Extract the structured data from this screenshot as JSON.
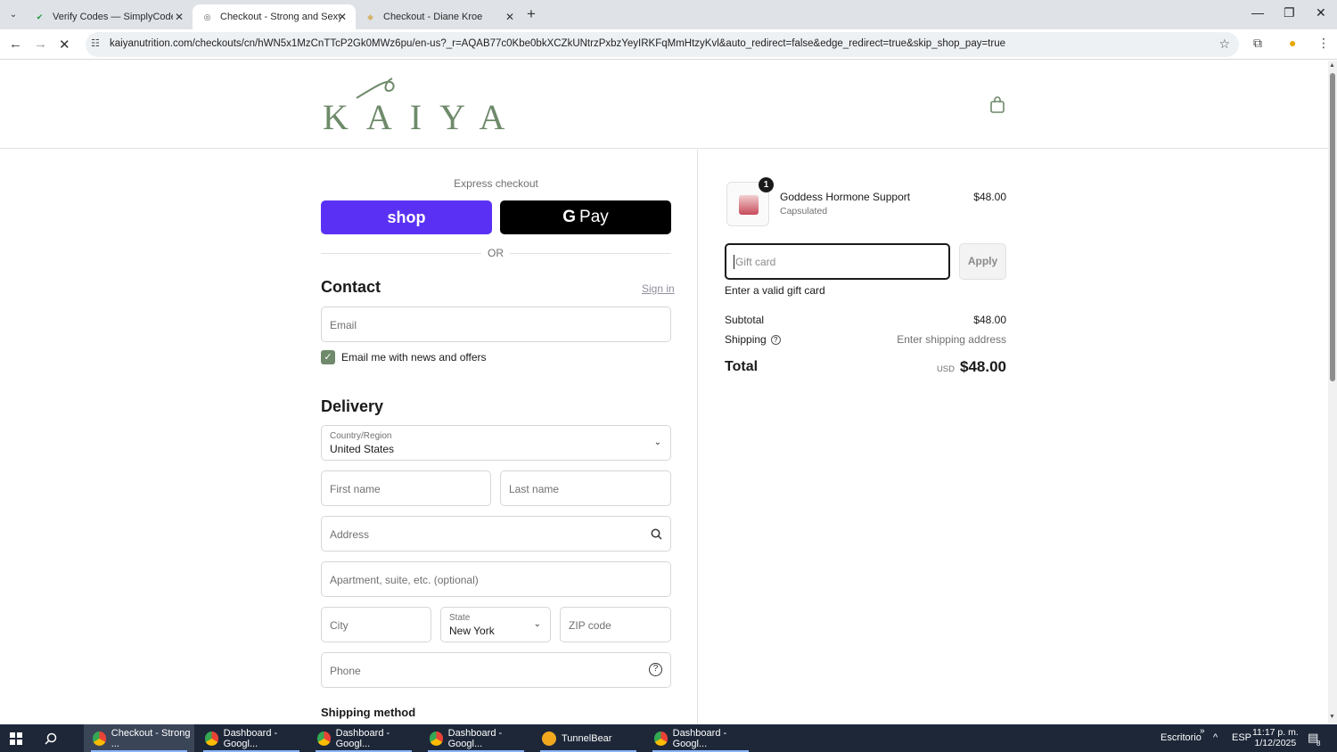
{
  "browser": {
    "tabs": [
      {
        "title": "Verify Codes — SimplyCodes",
        "favicon": "simplycodes-icon",
        "active": false
      },
      {
        "title": "Checkout - Strong and Sexy Fit",
        "favicon": "kaiya-icon",
        "active": true
      },
      {
        "title": "Checkout - Diane Kroe",
        "favicon": "dk-icon",
        "active": false
      }
    ],
    "url": "kaiyanutrition.com/checkouts/cn/hWN5x1MzCnTTcP2Gk0MWz6pu/en-us?_r=AQAB77c0Kbe0bkXCZkUNtrzPxbzYeyIRKFqMmHtzyKvl&auto_redirect=false&edge_redirect=true&skip_shop_pay=true"
  },
  "store": {
    "logo_text": "KAIYA",
    "brand_color": "#6e8a6a"
  },
  "checkout": {
    "express_label": "Express checkout",
    "shop_button": "shop",
    "gpay_button": "Pay",
    "or_label": "OR",
    "contact": {
      "heading": "Contact",
      "sign_in": "Sign in",
      "email_placeholder": "Email",
      "newsletter_label": "Email me with news and offers",
      "newsletter_checked": true
    },
    "delivery": {
      "heading": "Delivery",
      "country_label": "Country/Region",
      "country_value": "United States",
      "first_name_placeholder": "First name",
      "last_name_placeholder": "Last name",
      "address_placeholder": "Address",
      "apartment_placeholder": "Apartment, suite, etc. (optional)",
      "city_placeholder": "City",
      "state_label": "State",
      "state_value": "New York",
      "zip_placeholder": "ZIP code",
      "phone_placeholder": "Phone"
    },
    "shipping_method_heading": "Shipping method"
  },
  "summary": {
    "item": {
      "quantity": "1",
      "name": "Goddess Hormone Support",
      "variant": "Capsulated",
      "price": "$48.00"
    },
    "gift_card_placeholder": "Gift card",
    "apply_label": "Apply",
    "gift_card_error": "Enter a valid gift card",
    "subtotal_label": "Subtotal",
    "subtotal_value": "$48.00",
    "shipping_label": "Shipping",
    "shipping_value": "Enter shipping address",
    "total_label": "Total",
    "total_currency": "USD",
    "total_value": "$48.00"
  },
  "taskbar": {
    "items": [
      {
        "label": "Checkout - Strong ...",
        "icon": "chrome-icon"
      },
      {
        "label": "Dashboard - Googl...",
        "icon": "chrome-icon"
      },
      {
        "label": "Dashboard - Googl...",
        "icon": "chrome-icon"
      },
      {
        "label": "Dashboard - Googl...",
        "icon": "chrome-icon"
      },
      {
        "label": "TunnelBear",
        "icon": "tunnelbear-icon"
      },
      {
        "label": "Dashboard - Googl...",
        "icon": "chrome-icon"
      }
    ],
    "desktop_label": "Escritorio",
    "language": "ESP",
    "time": "11:17 p. m.",
    "date": "1/12/2025",
    "notifications": "8"
  }
}
